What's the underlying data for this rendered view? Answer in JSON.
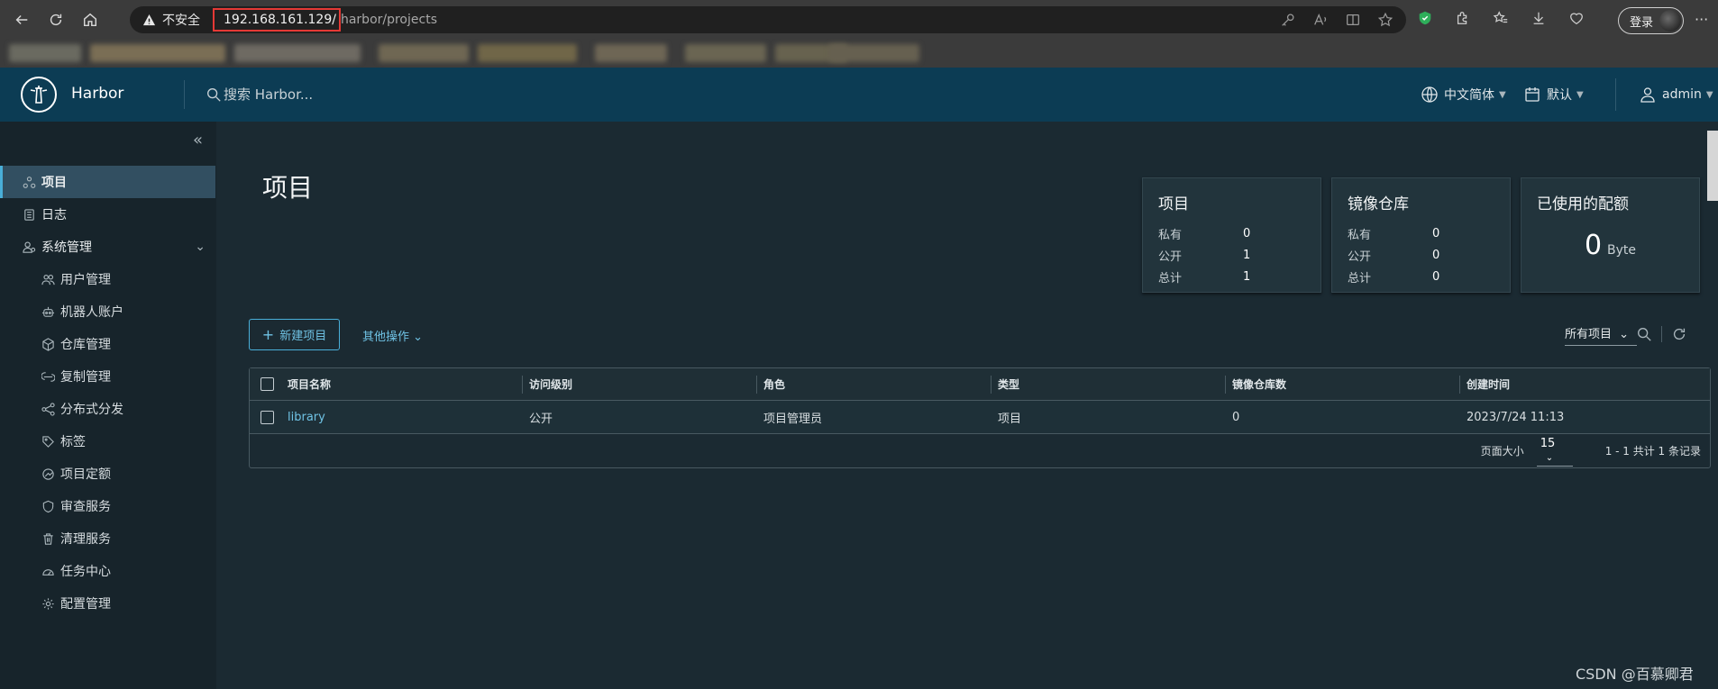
{
  "browser": {
    "warning": "不安全",
    "url_host": "192.168.161.129/",
    "url_path": "harbor/projects",
    "login": "登录",
    "more": "···"
  },
  "header": {
    "brand": "Harbor",
    "search_placeholder": "搜索 Harbor...",
    "language": "中文简体",
    "datetime": "默认",
    "user": "admin"
  },
  "sidebar": {
    "items": [
      {
        "label": "项目",
        "icon": "projects-icon",
        "active": true
      },
      {
        "label": "日志",
        "icon": "logs-icon"
      },
      {
        "label": "系统管理",
        "icon": "admin-icon"
      }
    ],
    "sub_items": [
      {
        "label": "用户管理",
        "icon": "users-icon"
      },
      {
        "label": "机器人账户",
        "icon": "robot-icon"
      },
      {
        "label": "仓库管理",
        "icon": "registry-icon"
      },
      {
        "label": "复制管理",
        "icon": "replication-icon"
      },
      {
        "label": "分布式分发",
        "icon": "distribution-icon"
      },
      {
        "label": "标签",
        "icon": "tag-icon"
      },
      {
        "label": "项目定额",
        "icon": "quota-icon"
      },
      {
        "label": "审查服务",
        "icon": "shield-icon"
      },
      {
        "label": "清理服务",
        "icon": "trash-icon"
      },
      {
        "label": "任务中心",
        "icon": "dashboard-icon"
      },
      {
        "label": "配置管理",
        "icon": "gear-icon"
      }
    ]
  },
  "main": {
    "title": "项目",
    "cards": {
      "projects": {
        "title": "项目",
        "private_label": "私有",
        "private": "0",
        "public_label": "公开",
        "public": "1",
        "total_label": "总计",
        "total": "1"
      },
      "repos": {
        "title": "镜像仓库",
        "private_label": "私有",
        "private": "0",
        "public_label": "公开",
        "public": "0",
        "total_label": "总计",
        "total": "0"
      },
      "quota": {
        "title": "已使用的配额",
        "value": "0",
        "unit": "Byte"
      }
    },
    "new_project": "新建项目",
    "other_ops": "其他操作",
    "filter": "所有项目",
    "table": {
      "columns": [
        "项目名称",
        "访问级别",
        "角色",
        "类型",
        "镜像仓库数",
        "创建时间"
      ],
      "rows": [
        [
          "library",
          "公开",
          "项目管理员",
          "项目",
          "0",
          "2023/7/24 11:13"
        ]
      ],
      "page_size_label": "页面大小",
      "page_size": "15",
      "summary": "1 - 1 共计 1 条记录"
    }
  },
  "watermark": "CSDN @百慕卿君"
}
